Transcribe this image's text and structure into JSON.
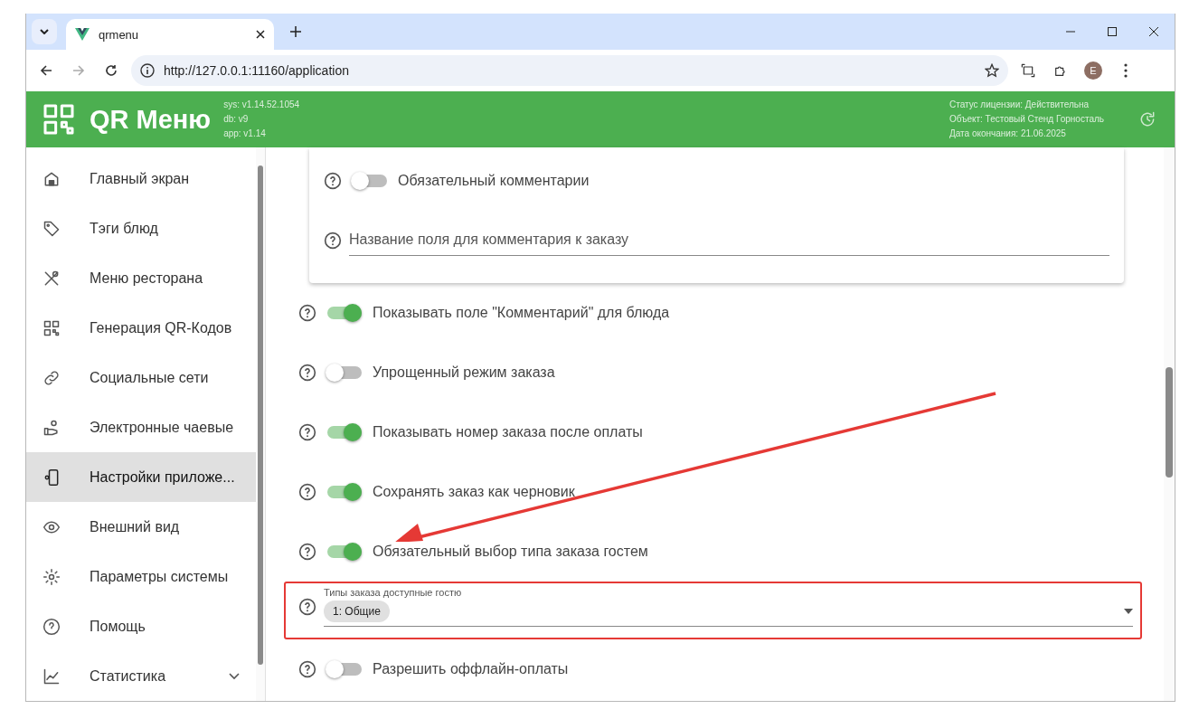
{
  "browser": {
    "tab_title": "qrmenu",
    "url": "http://127.0.0.1:11160/application",
    "profile_initial": "E"
  },
  "header": {
    "title": "QR Меню",
    "versions": [
      "sys: v1.14.52.1054",
      "db: v9",
      "app: v1.14"
    ],
    "license": [
      "Статус лицензии: Действительна",
      "Объект: Тестовый Стенд Горносталь",
      "Дата окончания: 21.06.2025"
    ]
  },
  "sidebar": {
    "items": [
      {
        "label": "Главный экран",
        "kind": "link",
        "selected": false
      },
      {
        "label": "Тэги блюд",
        "kind": "link",
        "selected": false
      },
      {
        "label": "Меню ресторана",
        "kind": "link",
        "selected": false
      },
      {
        "label": "Генерация QR-Кодов",
        "kind": "link",
        "selected": false
      },
      {
        "label": "Социальные сети",
        "kind": "link",
        "selected": false
      },
      {
        "label": "Электронные чаевые",
        "kind": "link",
        "selected": false
      },
      {
        "label": "Настройки приложе...",
        "kind": "link",
        "selected": true
      },
      {
        "label": "Внешний вид",
        "kind": "link",
        "selected": false
      },
      {
        "label": "Параметры системы",
        "kind": "link",
        "selected": false
      },
      {
        "label": "Помощь",
        "kind": "link",
        "selected": false
      },
      {
        "label": "Статистика",
        "kind": "group",
        "selected": false,
        "expanded": false
      }
    ]
  },
  "card": {
    "items": [
      {
        "kind": "switch",
        "label": "Обязательный комментарии",
        "on": false
      },
      {
        "kind": "text_field",
        "placeholder": "Название поля для комментария к заказу"
      }
    ]
  },
  "settings": [
    {
      "kind": "switch",
      "label": "Показывать поле \"Комментарий\" для блюда",
      "on": true
    },
    {
      "kind": "switch",
      "label": "Упрощенный режим заказа",
      "on": false
    },
    {
      "kind": "switch",
      "label": "Показывать номер заказа после оплаты",
      "on": true
    },
    {
      "kind": "switch",
      "label": "Сохранять заказ как черновик",
      "on": true
    },
    {
      "kind": "switch",
      "label": "Обязательный выбор типа заказа гостем",
      "on": true
    },
    {
      "kind": "select",
      "label": "Типы заказа доступные гостю",
      "chips": [
        "1: Общие"
      ],
      "highlighted": true
    },
    {
      "kind": "switch",
      "label": "Разрешить оффлайн-оплаты",
      "on": false
    }
  ]
}
